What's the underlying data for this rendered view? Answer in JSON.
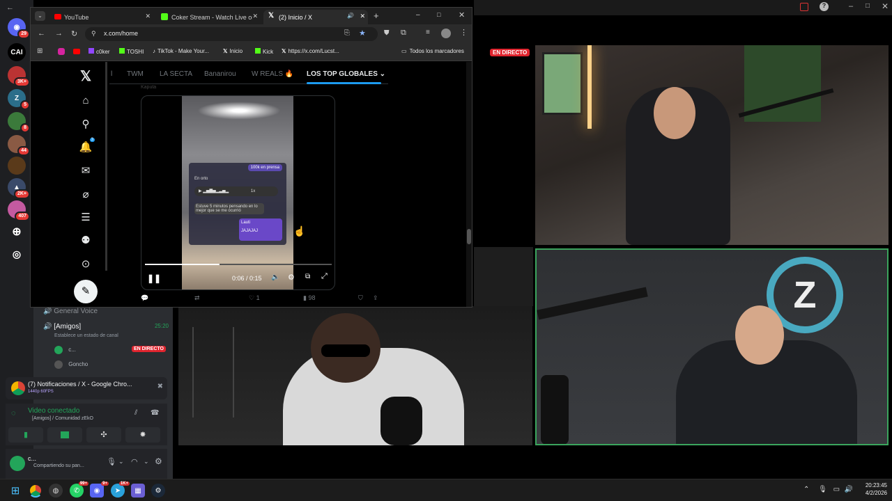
{
  "browser": {
    "tabs": [
      {
        "label": "YouTube",
        "icon": "youtube-icon",
        "color": "#ff0000"
      },
      {
        "label": "Coker Stream - Watch Live on",
        "icon": "kick-icon",
        "color": "#53fc18"
      },
      {
        "label": "(2) Inicio / X",
        "icon": "x-logo-icon",
        "color": "#ffffff"
      }
    ],
    "url": "x.com/home",
    "bookmarks": [
      "c0ker",
      "TOSHI",
      "TikTok - Make Your...",
      "Inicio",
      "Kick",
      "https://x.com/Lucst...",
      "Todos los marcadores"
    ]
  },
  "x": {
    "tabs": [
      "l",
      "TWM",
      "LA SECTA",
      "Bananirou",
      "W REALS 🔥",
      "LOS TOP GLOBALES"
    ],
    "active_tab": "LOS TOP GLOBALES",
    "notif_count": "3",
    "video": {
      "time": "0:06 / 0:15",
      "progress": 0.4,
      "chat": {
        "top_msg": "100k en prensa",
        "label": "En orto",
        "speed": "1x",
        "msg1": "Estuve 5 minutos pensando en lo mejor que se me ocurrió",
        "user": "Lauti",
        "msg2": "JAJAJAJ"
      }
    },
    "actions": {
      "likes": "1",
      "views": "98"
    },
    "post_author": "Kaputa"
  },
  "discord": {
    "servers": [
      {
        "icon": "discord-icon",
        "badge": "29"
      },
      {
        "icon": "cai-server-icon",
        "label": "CAI",
        "badge": ""
      },
      {
        "icon": "server-avatar-icon",
        "badge": "3K+"
      },
      {
        "icon": "zeko-server-icon",
        "badge": "5"
      },
      {
        "icon": "server-avatar-icon",
        "badge": "8"
      },
      {
        "icon": "server-avatar-icon",
        "badge": "44"
      },
      {
        "icon": "server-avatar-icon",
        "badge": ""
      },
      {
        "icon": "server-avatar-icon",
        "badge": "2K+"
      },
      {
        "icon": "server-avatar-icon",
        "badge": "407"
      }
    ],
    "channels": {
      "general_voice": "General Voice",
      "amigos": "[Amigos]",
      "amigos_time": "25:20",
      "status_prompt": "Establece un estado de canal",
      "member1": "c...",
      "live_badge": "EN DIRECTO",
      "member2": "Goncho"
    },
    "stream_popup": {
      "title": "(7) Notificaciones / X - Google Chro...",
      "quality": "1440p 60FPS"
    },
    "voice": {
      "status": "Video conectado",
      "channel": "[Amigos] / Comunidad zEkO"
    },
    "user": {
      "name": "c...",
      "status": "Compartiendo su pan..."
    }
  },
  "stream_live_badge": "EN DIRECTO",
  "taskbar": {
    "time": "20:23:45",
    "date": "4/2/2026",
    "badges": {
      "whatsapp": "99+",
      "discord": "9+",
      "telegram": "1K+"
    }
  },
  "colors": {
    "live": "#e0242e",
    "discord_green": "#23a55a",
    "x_blue": "#1d9bf0",
    "active_tile_border": "#3ba55d"
  }
}
